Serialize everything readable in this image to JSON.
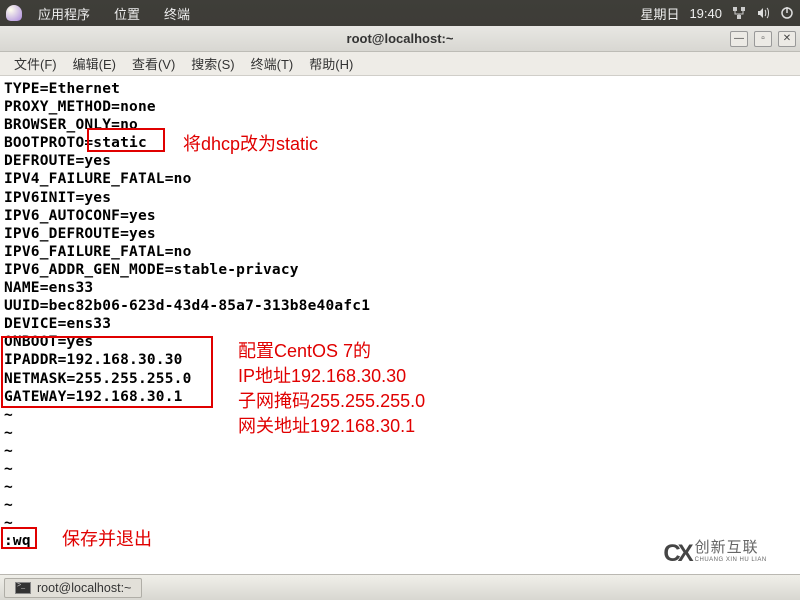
{
  "topbar": {
    "apps": "应用程序",
    "places": "位置",
    "terminal": "终端",
    "day": "星期日",
    "time": "19:40"
  },
  "window": {
    "title": "root@localhost:~"
  },
  "menu": {
    "file": "文件(F)",
    "edit": "编辑(E)",
    "view": "查看(V)",
    "search": "搜索(S)",
    "terminal": "终端(T)",
    "help": "帮助(H)"
  },
  "config": {
    "l1": "TYPE=Ethernet",
    "l2": "PROXY_METHOD=none",
    "l3": "BROWSER_ONLY=no",
    "l4": "BOOTPROTO=static",
    "l5": "DEFROUTE=yes",
    "l6": "IPV4_FAILURE_FATAL=no",
    "l7": "IPV6INIT=yes",
    "l8": "IPV6_AUTOCONF=yes",
    "l9": "IPV6_DEFROUTE=yes",
    "l10": "IPV6_FAILURE_FATAL=no",
    "l11": "IPV6_ADDR_GEN_MODE=stable-privacy",
    "l12": "NAME=ens33",
    "l13": "UUID=bec82b06-623d-43d4-85a7-313b8e40afc1",
    "l14": "DEVICE=ens33",
    "l15": "ONBOOT=yes",
    "l16": "IPADDR=192.168.30.30",
    "l17": "NETMASK=255.255.255.0",
    "l18": "GATEWAY=192.168.30.1",
    "cmd": ":wq"
  },
  "annotations": {
    "a1": "将dhcp改为static",
    "a2l1": "配置CentOS 7的",
    "a2l2": "IP地址192.168.30.30",
    "a2l3": "子网掩码255.255.255.0",
    "a2l4": "网关地址192.168.30.1",
    "a3": "保存并退出"
  },
  "taskbar": {
    "item1": "root@localhost:~"
  },
  "watermark": {
    "cn": "创新互联",
    "py": "CHUANG XIN HU LIAN"
  }
}
